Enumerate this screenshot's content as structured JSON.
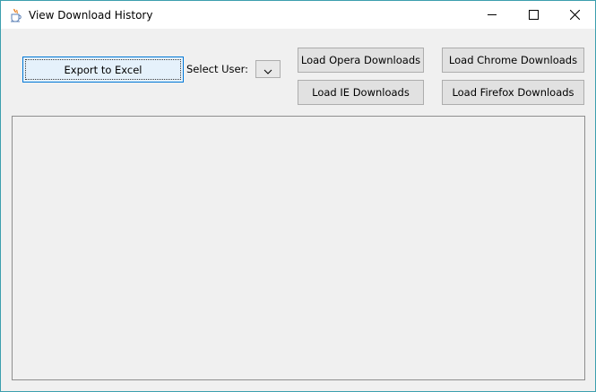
{
  "window": {
    "title": "View Download History",
    "app_icon": "java-coffee-cup-icon",
    "controls": {
      "minimize_icon": "minimize-icon",
      "maximize_icon": "maximize-icon",
      "close_icon": "close-icon"
    }
  },
  "toolbar": {
    "export_label": "Export to Excel",
    "select_user_label": "Select User:",
    "user_combo": {
      "selected_value": "",
      "arrow_icon": "chevron-down-icon"
    },
    "load_opera_label": "Load Opera Downloads",
    "load_chrome_label": "Load Chrome Downloads",
    "load_ie_label": "Load IE Downloads",
    "load_firefox_label": "Load Firefox Downloads"
  },
  "colors": {
    "title_bar": "#ffffff",
    "window_body": "#f0f0f0",
    "window_border": "#3c9fae",
    "focused_button_bg": "#e5f1fb",
    "focused_button_border": "#0078d7",
    "button_bg": "#e1e1e1",
    "button_border": "#adadad"
  }
}
